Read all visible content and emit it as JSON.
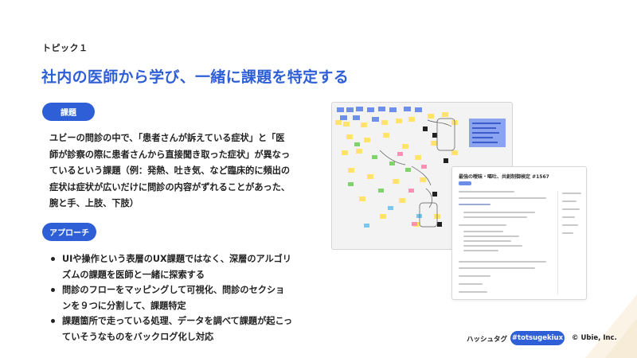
{
  "topic_label": "トピック１",
  "title": "社内の医師から学び、一緒に課題を特定する",
  "sections": {
    "problem": {
      "label": "課題",
      "lines": [
        "ユビーの問診の中で、「患者さんが訴えている症状」と「医",
        "師が診察の際に患者さんから直接聞き取った症状」が異なっ",
        "ているという課題（例：発熱、吐き気、など臨床的に頻出の",
        "症状は症状が広いだけに問診の内容がずれることがあった、",
        "腕と手、上肢、下肢）"
      ]
    },
    "approach": {
      "label": "アプローチ",
      "bullets": [
        [
          "UIや操作という表層のUX課題ではなく、深層のアルゴリ",
          "ズムの課題を医師と一緒に探索する"
        ],
        [
          "問診のフローをマッピングして可視化、問診のセクショ",
          "ンを９つに分割して、課題特定"
        ],
        [
          "課題箇所で走っている処理、データを調べて課題が起こっ",
          "ていそうなものをバックログ化し対応"
        ]
      ]
    }
  },
  "screenshot_doc": {
    "title": "最強の曖昧・嘔吐、共創制御検定 #1567"
  },
  "footer": {
    "hashtag_label": "ハッシュタグ",
    "hashtag": "#totsugekiux",
    "copyright": "© Ubie, Inc."
  },
  "colors": {
    "accent": "#2f5fd6",
    "text": "#222222"
  }
}
